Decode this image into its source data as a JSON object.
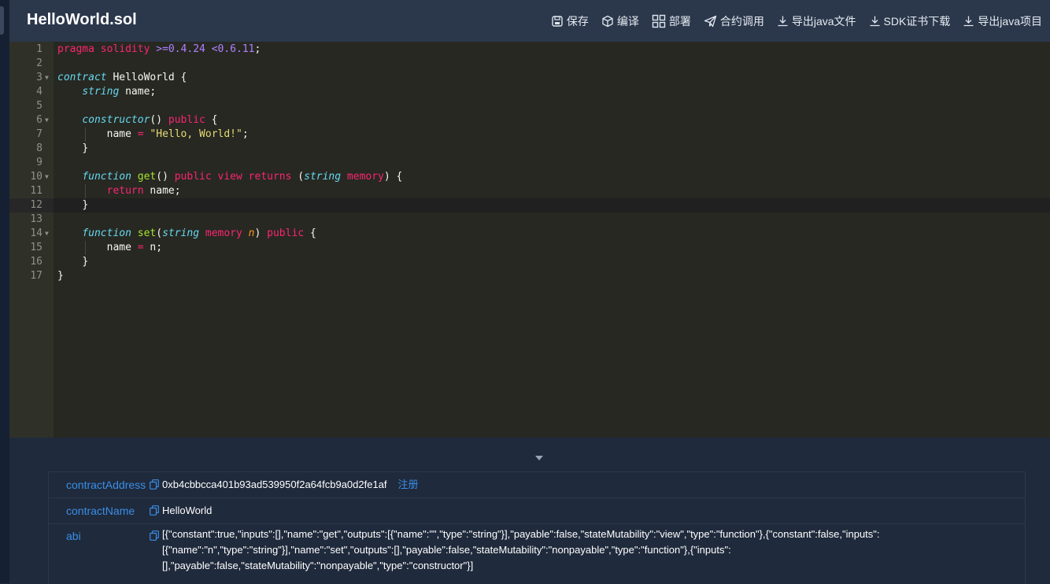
{
  "header": {
    "title": "HelloWorld.sol",
    "toolbar": {
      "save": "保存",
      "compile": "编译",
      "deploy": "部署",
      "invoke": "合约调用",
      "export_java": "导出java文件",
      "sdk_download": "SDK证书下载",
      "export_project": "导出java项目"
    }
  },
  "editor": {
    "line_numbers": [
      "1",
      "2",
      "3",
      "4",
      "5",
      "6",
      "7",
      "8",
      "9",
      "10",
      "11",
      "12",
      "13",
      "14",
      "15",
      "16",
      "17"
    ],
    "code": {
      "l1_pragma": "pragma",
      "l1_solidity": "solidity",
      "l1_op1": ">=",
      "l1_ver1": "0.4.24",
      "l1_op2": "<",
      "l1_ver2": "0.6.11",
      "l1_end": ";",
      "l3_contract": "contract",
      "l3_name": " HelloWorld {",
      "l4_type": "string",
      "l4_rest": " name;",
      "l6_ctor": "constructor",
      "l6_paren": "() ",
      "l6_public": "public",
      "l6_brace": " {",
      "l7_name": "name ",
      "l7_eq": "=",
      "l7_sp": " ",
      "l7_str": "\"Hello, World!\"",
      "l7_end": ";",
      "l8_close": "}",
      "l10_function": "function",
      "l10_sp": " ",
      "l10_get": "get",
      "l10_paren": "() ",
      "l10_public": "public",
      "l10_sp2": " ",
      "l10_view": "view",
      "l10_sp3": " ",
      "l10_returns": "returns",
      "l10_open": " (",
      "l10_type": "string",
      "l10_sp4": " ",
      "l10_memory": "memory",
      "l10_close": ") {",
      "l11_return": "return",
      "l11_rest": " name;",
      "l12_close": "}",
      "l14_function": "function",
      "l14_sp": " ",
      "l14_set": "set",
      "l14_open": "(",
      "l14_type": "string",
      "l14_sp2": " ",
      "l14_memory": "memory",
      "l14_sp3": " ",
      "l14_n": "n",
      "l14_close": ") ",
      "l14_public": "public",
      "l14_brace": " {",
      "l15_name": "name ",
      "l15_eq": "=",
      "l15_rest": " n;",
      "l16_close": "}",
      "l17_close": "}"
    }
  },
  "result": {
    "contractAddress_label": "contractAddress",
    "contractAddress_value": "0xb4cbbcca401b93ad539950f2a64fcb9a0d2fe1af",
    "register_label": "注册",
    "contractName_label": "contractName",
    "contractName_value": "HelloWorld",
    "abi_label": "abi",
    "abi_line1": "[{\"constant\":true,\"inputs\":[],\"name\":\"get\",\"outputs\":[{\"name\":\"\",\"type\":\"string\"}],\"payable\":false,\"stateMutability\":\"view\",\"type\":\"function\"},{\"constant\":false,\"inputs\":",
    "abi_line2": "[{\"name\":\"n\",\"type\":\"string\"}],\"name\":\"set\",\"outputs\":[],\"payable\":false,\"stateMutability\":\"nonpayable\",\"type\":\"function\"},{\"inputs\":",
    "abi_line3": "[],\"payable\":false,\"stateMutability\":\"nonpayable\",\"type\":\"constructor\"}]"
  },
  "colors": {
    "accent": "#3a8ee6",
    "header_bg": "#2b374b",
    "editor_bg": "#272822"
  }
}
